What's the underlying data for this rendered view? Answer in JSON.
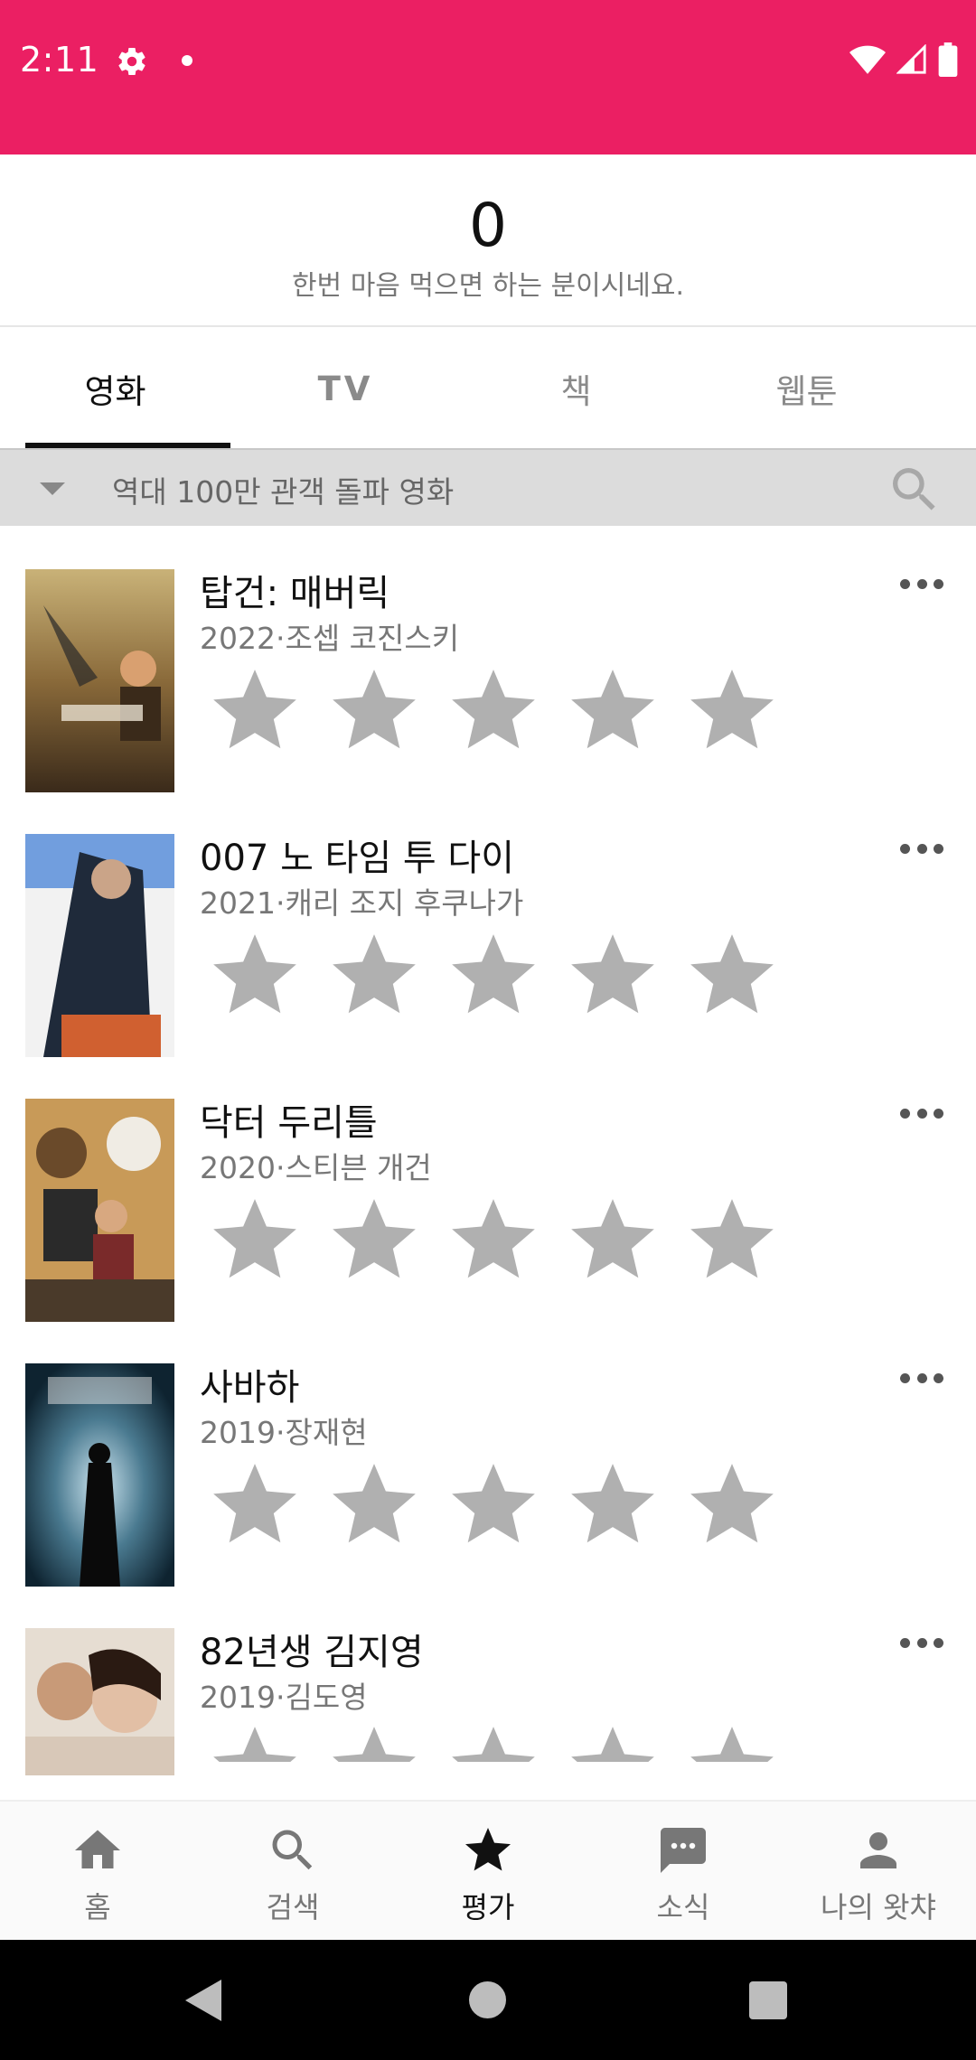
{
  "status_bar": {
    "time": "2:11",
    "background_color": "#eb1f63",
    "icons": [
      "gear-icon",
      "notification-dot-icon",
      "wifi-icon",
      "signal-icon",
      "battery-icon"
    ]
  },
  "score": {
    "value": "0",
    "message": "한번 마음 먹으면 하는 분이시네요."
  },
  "tabs": [
    {
      "label": "영화",
      "active": true
    },
    {
      "label": "TV",
      "active": false
    },
    {
      "label": "책",
      "active": false
    },
    {
      "label": "웹툰",
      "active": false
    }
  ],
  "filter": {
    "label": "역대 100만 관객 돌파 영화",
    "icons": [
      "caret-down-icon",
      "search-icon"
    ]
  },
  "movies": [
    {
      "title": "탑건: 매버릭",
      "meta": "2022·조셉 코진스키",
      "rating": 0,
      "max_rating": 5
    },
    {
      "title": "007 노 타임 투 다이",
      "meta": "2021·캐리 조지 후쿠나가",
      "rating": 0,
      "max_rating": 5
    },
    {
      "title": "닥터 두리틀",
      "meta": "2020·스티븐 개건",
      "rating": 0,
      "max_rating": 5
    },
    {
      "title": "사바하",
      "meta": "2019·장재현",
      "rating": 0,
      "max_rating": 5
    },
    {
      "title": "82년생 김지영",
      "meta": "2019·김도영",
      "rating": 0,
      "max_rating": 5
    }
  ],
  "bottom_nav": [
    {
      "label": "홈",
      "icon": "home-icon",
      "active": false
    },
    {
      "label": "검색",
      "icon": "search-icon",
      "active": false
    },
    {
      "label": "평가",
      "icon": "star-icon",
      "active": true
    },
    {
      "label": "소식",
      "icon": "chat-icon",
      "active": false
    },
    {
      "label": "나의 왓챠",
      "icon": "person-icon",
      "active": false
    }
  ],
  "colors": {
    "accent": "#eb1f63",
    "star_empty": "#b0b0b0",
    "filter_bg": "#dcdcdc"
  }
}
